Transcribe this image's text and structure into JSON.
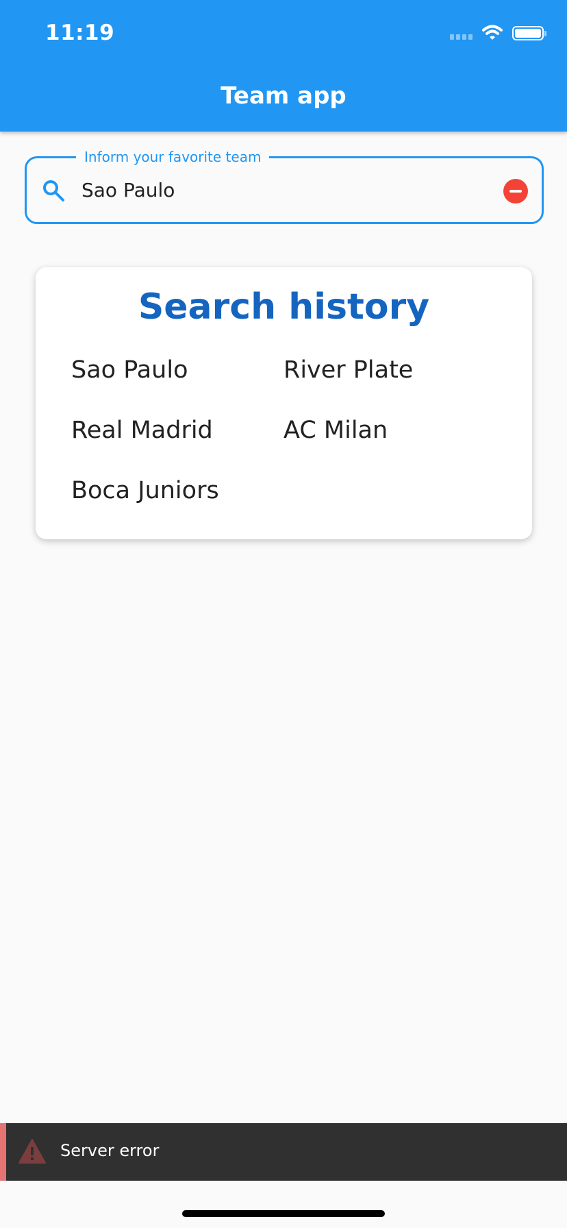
{
  "status_bar": {
    "time": "11:19",
    "icons": [
      "cellular-signal-icon",
      "wifi-icon",
      "battery-icon"
    ]
  },
  "app_bar": {
    "title": "Team app"
  },
  "search": {
    "label": "Inform your favorite team",
    "value": "Sao Paulo",
    "leading_icon": "search-icon",
    "trailing_icon": "remove-circle-icon"
  },
  "history": {
    "title": "Search history",
    "items": [
      "Sao Paulo",
      "River Plate",
      "Real Madrid",
      "AC Milan",
      "Boca Juniors"
    ]
  },
  "snackbar": {
    "icon": "warning-icon",
    "message": "Server error"
  },
  "colors": {
    "primary": "#2196f3",
    "title_blue": "#1565c0",
    "error_red": "#f44336",
    "snackbar_bg": "#303030",
    "snackbar_accent": "#e57373"
  }
}
